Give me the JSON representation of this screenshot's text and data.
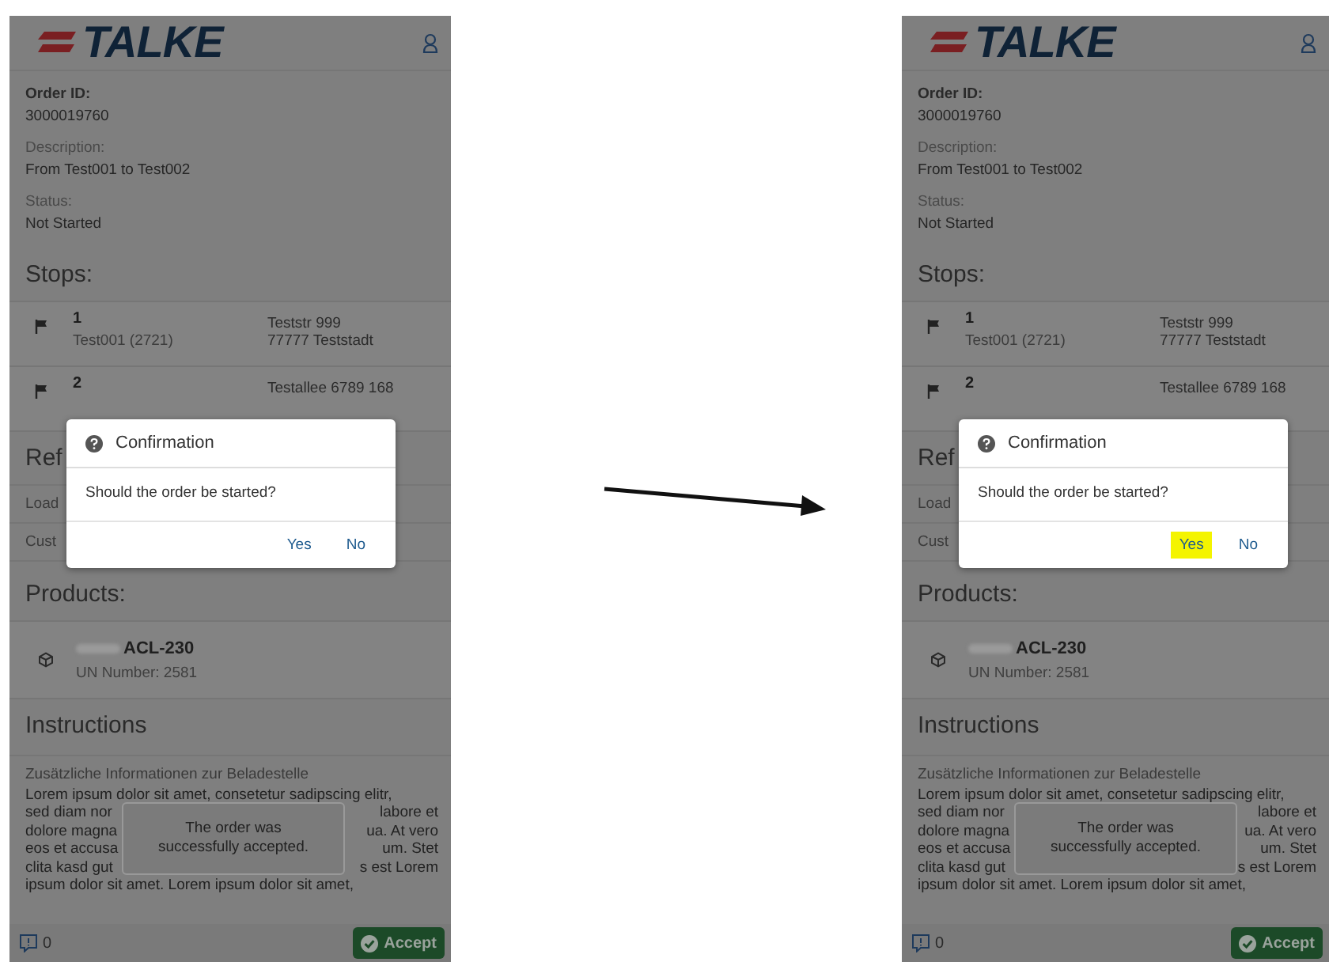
{
  "screens": [
    {
      "logo": "TALKE",
      "fields": [
        {
          "label": "Order ID:",
          "value": "3000019760",
          "label_bold": true
        },
        {
          "label": "Description:",
          "value": "From Test001 to Test002",
          "label_bold": false
        },
        {
          "label": "Status:",
          "value": "Not Started",
          "label_bold": false
        }
      ],
      "stops_title": "Stops:",
      "stops": [
        {
          "number": "1",
          "name": "Test001 (2721)",
          "address": [
            "Teststr 999",
            "77777 Teststadt"
          ]
        },
        {
          "number": "2",
          "address": [
            "Testallee 6789 168"
          ]
        }
      ],
      "references": {
        "title": "Ref",
        "rows": [
          "Load",
          "Cust"
        ]
      },
      "products_title": "Products:",
      "products": [
        {
          "name": "ACL-230",
          "un_number": "UN Number: 2581"
        }
      ],
      "instructions_title": "Instructions",
      "instructions": {
        "heading": "Zusätzliche Informationen zur Beladestelle",
        "lines": [
          {
            "left": "Lorem ipsum dolor sit amet, consetetur sadipscing elitr,"
          },
          {
            "left": "sed diam nor",
            "right": "labore et"
          },
          {
            "left": "dolore magna",
            "right": "ua. At vero"
          },
          {
            "left": "eos et accusa",
            "right": "um. Stet"
          },
          {
            "left": "clita kasd gut",
            "right": "s est Lorem"
          },
          {
            "left": "ipsum dolor sit amet. Lorem ipsum dolor sit amet,"
          }
        ]
      },
      "dialog": {
        "title": "Confirmation",
        "message": "Should the order be started?",
        "buttons": [
          {
            "label": "Yes",
            "highlighted": false
          },
          {
            "label": "No",
            "highlighted": false
          }
        ]
      },
      "toast": [
        "The order was",
        "successfully accepted."
      ],
      "footer": {
        "count": "0",
        "accept": "Accept"
      }
    },
    {
      "logo": "TALKE",
      "fields": [
        {
          "label": "Order ID:",
          "value": "3000019760",
          "label_bold": true
        },
        {
          "label": "Description:",
          "value": "From Test001 to Test002",
          "label_bold": false
        },
        {
          "label": "Status:",
          "value": "Not Started",
          "label_bold": false
        }
      ],
      "stops_title": "Stops:",
      "stops": [
        {
          "number": "1",
          "name": "Test001 (2721)",
          "address": [
            "Teststr 999",
            "77777 Teststadt"
          ]
        },
        {
          "number": "2",
          "address": [
            "Testallee 6789 168"
          ]
        }
      ],
      "references": {
        "title": "Ref",
        "rows": [
          "Load",
          "Cust"
        ]
      },
      "products_title": "Products:",
      "products": [
        {
          "name": "ACL-230",
          "un_number": "UN Number: 2581"
        }
      ],
      "instructions_title": "Instructions",
      "instructions": {
        "heading": "Zusätzliche Informationen zur Beladestelle",
        "lines": [
          {
            "left": "Lorem ipsum dolor sit amet, consetetur sadipscing elitr,"
          },
          {
            "left": "sed diam nor",
            "right": "labore et"
          },
          {
            "left": "dolore magna",
            "right": "ua. At vero"
          },
          {
            "left": "eos et accusa",
            "right": "um. Stet"
          },
          {
            "left": "clita kasd gut",
            "right": "s est Lorem"
          },
          {
            "left": "ipsum dolor sit amet. Lorem ipsum dolor sit amet,"
          }
        ]
      },
      "dialog": {
        "title": "Confirmation",
        "message": "Should the order be started?",
        "buttons": [
          {
            "label": "Yes",
            "highlighted": true
          },
          {
            "label": "No",
            "highlighted": false
          }
        ]
      },
      "toast": [
        "The order was",
        "successfully accepted."
      ],
      "footer": {
        "count": "0",
        "accept": "Accept"
      }
    }
  ]
}
